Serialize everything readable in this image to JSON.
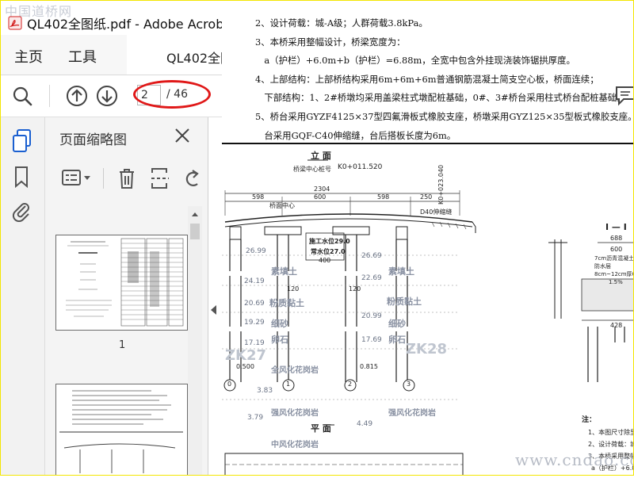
{
  "watermark_top": "中国道桥网",
  "window": {
    "title": "QL402全图纸.pdf - Adobe Acrobat Pro"
  },
  "menu": {
    "home": "主页",
    "tools": "工具",
    "doc_tab": "QL402全图纸."
  },
  "toolbar": {
    "page_current": "2",
    "page_total": "/ 46"
  },
  "panel": {
    "title": "页面缩略图",
    "thumb1_num": "1"
  },
  "document": {
    "notes": [
      "2、设计荷载：城-A级；人群荷载3.8kPa。",
      "3、本桥采用整幅设计，桥梁宽度为：",
      "　a（护栏）+6.0m+b（护栏）=6.88m，全宽中包含外挂现浇装饰锯拱厚度。",
      "4、上部结构：上部桥结构采用6m+6m+6m普通钢筋混凝土简支空心板，桥面连续；",
      "　下部结构：1、2#桥墩均采用盖梁柱式墩配桩基础，0#、3#桥台采用柱式桥台配桩基础。",
      "5、桥台采用GYZF4125×37型四氟滑板式橡胶支座，桥墩采用GYZ125×35型板式橡胶支座。0、3号桥",
      "　台采用GQF-C40伸缩缝，台后搭板长度为6m。"
    ],
    "drawing": {
      "elevation_title": "立 面",
      "center_label": "桥梁中心桩号",
      "center_station": "K0+011.520",
      "dim_total": "2304",
      "dim_left": "598",
      "dim_mid": "600",
      "dim_mid2": "600",
      "dim_right": "598",
      "dim_250": "250",
      "joint_label": "D40伸缩缝",
      "side_station": "K0+023.040",
      "pier_top_label": "桥面中心",
      "water_level": "施工水位29.0",
      "normal_level": "常水位27.0",
      "levels_left": [
        "26.99",
        "24.19",
        "20.69",
        "19.29",
        "17.19",
        "0.500"
      ],
      "levels_right": [
        "26.69",
        "22.69",
        "20.99",
        "17.69"
      ],
      "level_815": "0.815",
      "bearing_400": "400",
      "bearing_120a": "120",
      "bearing_120b": "120",
      "soil_labels": [
        "素填土",
        "粉质黏土",
        "细砂",
        "卵石",
        "全风化花岗岩",
        "强风化花岗岩",
        "中风化花岗岩"
      ],
      "pier_nums": [
        "0",
        "1",
        "2",
        "3"
      ],
      "plan_title": "平 面",
      "section_title": "I — I",
      "section_688": "688",
      "section_600": "600",
      "section_notes": [
        "7cm沥青混凝土铺装",
        "防水层",
        "8cm~12cm厚C40",
        "1.5%"
      ],
      "section_428": "428",
      "note_head": "注：",
      "bottom_notes": [
        "1、本图尺寸除里程",
        "2、设计荷载：城-",
        "3、本桥采用整幅",
        "a（护栏）+6.0"
      ],
      "stamp_left": "ZK27",
      "stamp_right": "ZK28",
      "depth_383": "3.83",
      "depth_379": "3.79",
      "depth_449": "4.49"
    }
  },
  "watermark_bottom": "www.cndao.com",
  "colors": {
    "accent_red": "#e01818",
    "cursor_blue": "#1a5fd0",
    "toolbar_gray": "#f7f7f7",
    "pdf_red": "#d31f1f"
  }
}
